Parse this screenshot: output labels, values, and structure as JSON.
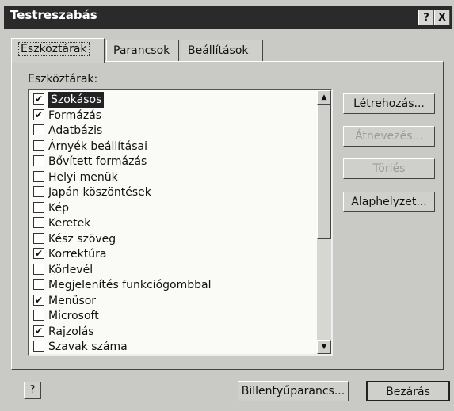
{
  "window": {
    "title": "Testreszabás",
    "help_glyph": "?",
    "close_glyph": "X"
  },
  "tabs": [
    {
      "label": "Eszköztárak",
      "active": true
    },
    {
      "label": "Parancsok",
      "active": false
    },
    {
      "label": "Beállítások",
      "active": false
    }
  ],
  "list": {
    "label": "Eszköztárak:",
    "items": [
      {
        "label": "Szokásos",
        "checked": true,
        "selected": true
      },
      {
        "label": "Formázás",
        "checked": true
      },
      {
        "label": "Adatbázis",
        "checked": false
      },
      {
        "label": "Árnyék beállításai",
        "checked": false
      },
      {
        "label": "Bővített formázás",
        "checked": false
      },
      {
        "label": "Helyi menük",
        "checked": false
      },
      {
        "label": "Japán köszöntések",
        "checked": false
      },
      {
        "label": "Kép",
        "checked": false
      },
      {
        "label": "Keretek",
        "checked": false
      },
      {
        "label": "Kész szöveg",
        "checked": false
      },
      {
        "label": "Korrektúra",
        "checked": true
      },
      {
        "label": "Körlevél",
        "checked": false
      },
      {
        "label": "Megjelenítés funkciógombbal",
        "checked": false
      },
      {
        "label": "Menüsor",
        "checked": true
      },
      {
        "label": "Microsoft",
        "checked": false
      },
      {
        "label": "Rajzolás",
        "checked": true
      },
      {
        "label": "Szavak száma",
        "checked": false
      }
    ]
  },
  "side_buttons": {
    "new": "Létrehozás...",
    "rename": "Átnevezés...",
    "delete": "Törlés",
    "reset": "Alaphelyzet..."
  },
  "bottom": {
    "help": "?",
    "keyboard": "Billentyűparancs...",
    "close": "Bezárás"
  }
}
